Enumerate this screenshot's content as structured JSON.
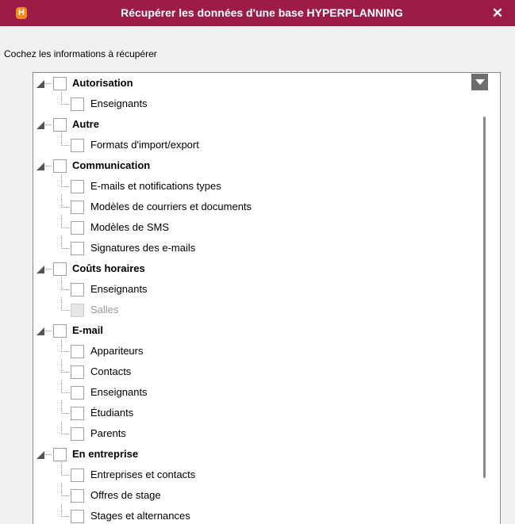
{
  "window": {
    "app_icon_letter": "H",
    "title": "Récupérer les données d'une base HYPERPLANNING",
    "close_glyph": "✕"
  },
  "instruction": "Cochez les informations à récupérer",
  "tree": [
    {
      "label": "Autorisation",
      "items": [
        {
          "label": "Enseignants",
          "disabled": false
        }
      ]
    },
    {
      "label": "Autre",
      "items": [
        {
          "label": "Formats d'import/export",
          "disabled": false
        }
      ]
    },
    {
      "label": "Communication",
      "items": [
        {
          "label": "E-mails et notifications types",
          "disabled": false
        },
        {
          "label": "Modèles de courriers et documents",
          "disabled": false
        },
        {
          "label": "Modèles de SMS",
          "disabled": false
        },
        {
          "label": "Signatures des e-mails",
          "disabled": false
        }
      ]
    },
    {
      "label": "Coûts horaires",
      "items": [
        {
          "label": "Enseignants",
          "disabled": false
        },
        {
          "label": "Salles",
          "disabled": true
        }
      ]
    },
    {
      "label": "E-mail",
      "items": [
        {
          "label": "Appariteurs",
          "disabled": false
        },
        {
          "label": "Contacts",
          "disabled": false
        },
        {
          "label": "Enseignants",
          "disabled": false
        },
        {
          "label": "Étudiants",
          "disabled": false
        },
        {
          "label": "Parents",
          "disabled": false
        }
      ]
    },
    {
      "label": "En entreprise",
      "items": [
        {
          "label": "Entreprises et contacts",
          "disabled": false
        },
        {
          "label": "Offres de stage",
          "disabled": false
        },
        {
          "label": "Stages et alternances",
          "disabled": false
        }
      ]
    }
  ],
  "colors": {
    "titlebar": "#9c1b47",
    "app_icon": "#f08a1c",
    "scrollbar": "#6d6d6d"
  },
  "icons": {
    "category_expander": "expanded-triangle-icon",
    "scroll_button": "chevron-down-icon"
  }
}
